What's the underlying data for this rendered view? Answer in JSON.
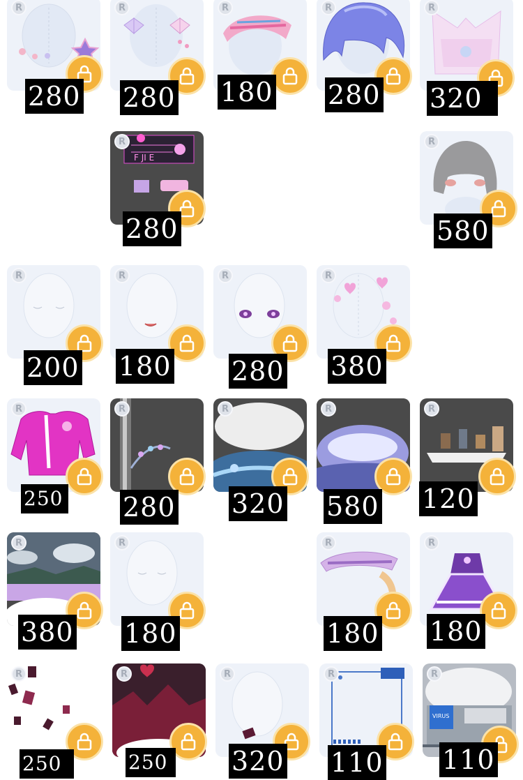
{
  "badge_letter": "R",
  "colors": {
    "lock": "#f4b23a",
    "tile": "#eef2f9",
    "price_bg": "#000000"
  },
  "items": [
    {
      "id": "r1c1",
      "price": "280",
      "art": "face-accessories"
    },
    {
      "id": "r1c2",
      "price": "280",
      "art": "bows"
    },
    {
      "id": "r1c3",
      "price": "180",
      "art": "visor-cap"
    },
    {
      "id": "r1c4",
      "price": "280",
      "art": "blue-hair"
    },
    {
      "id": "r1c5",
      "price": "320",
      "art": "pink-top"
    },
    {
      "id": "r2c2",
      "price": "280",
      "art": "neon-stickers"
    },
    {
      "id": "r2c5",
      "price": "580",
      "art": "gray-hair"
    },
    {
      "id": "r3c1",
      "price": "200",
      "art": "face-eyes-closed"
    },
    {
      "id": "r3c2",
      "price": "180",
      "art": "face-smile"
    },
    {
      "id": "r3c3",
      "price": "280",
      "art": "purple-eyes"
    },
    {
      "id": "r3c4",
      "price": "380",
      "art": "heart-stickers"
    },
    {
      "id": "r4c1",
      "price": "250",
      "art": "pink-jacket"
    },
    {
      "id": "r4c2",
      "price": "280",
      "art": "flower-frame"
    },
    {
      "id": "r4c3",
      "price": "320",
      "art": "blue-pond"
    },
    {
      "id": "r4c4",
      "price": "580",
      "art": "flower-field"
    },
    {
      "id": "r4c5",
      "price": "120",
      "art": "picnic"
    },
    {
      "id": "r5c1",
      "price": "380",
      "art": "lake-scene"
    },
    {
      "id": "r5c2",
      "price": "180",
      "art": "face-plain"
    },
    {
      "id": "r5c4",
      "price": "180",
      "art": "sun-hat"
    },
    {
      "id": "r5c5",
      "price": "180",
      "art": "purple-dress"
    },
    {
      "id": "r6c1",
      "price": "250",
      "art": "floating-cards"
    },
    {
      "id": "r6c2",
      "price": "250",
      "art": "red-city"
    },
    {
      "id": "r6c3",
      "price": "320",
      "art": "card-accessory"
    },
    {
      "id": "r6c4",
      "price": "110",
      "art": "tech-frame"
    },
    {
      "id": "r6c5",
      "price": "110",
      "art": "stage-room"
    }
  ]
}
